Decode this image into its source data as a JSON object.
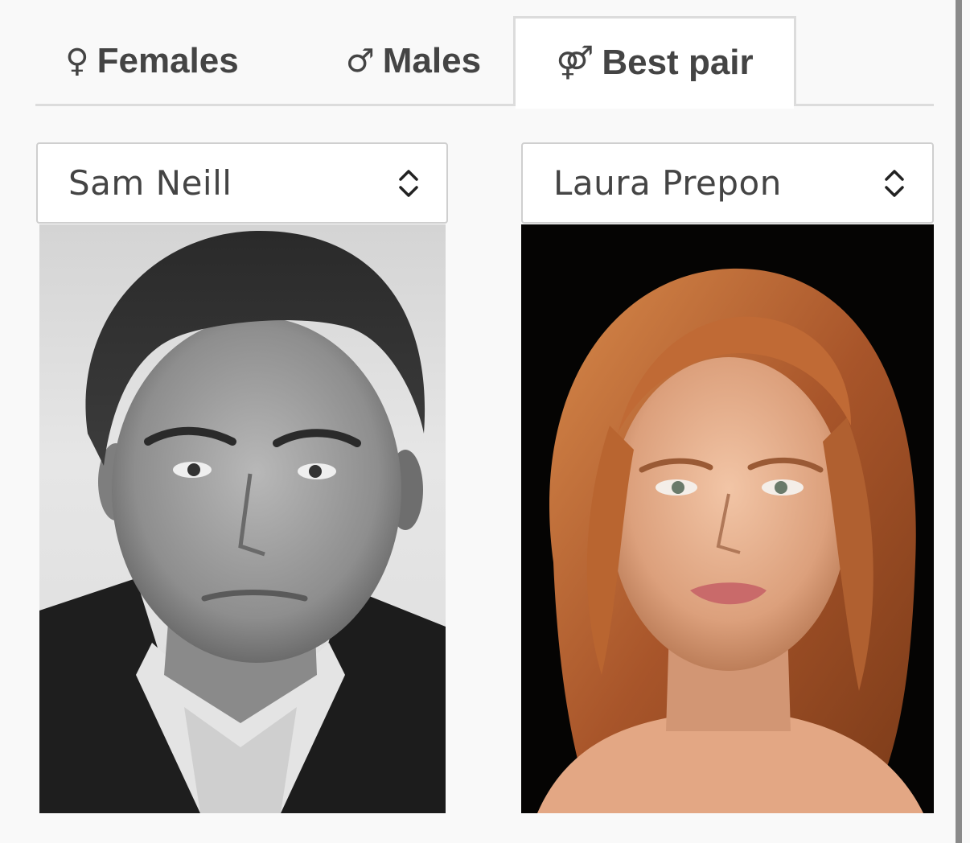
{
  "tabs": [
    {
      "symbol": "♀",
      "label": "Females"
    },
    {
      "symbol": "♂",
      "label": "Males"
    },
    {
      "symbol": "⚤",
      "label": "Best pair"
    }
  ],
  "active_tab": "Best pair",
  "selects": {
    "left": {
      "value": "Sam Neill",
      "icon": "updown-chevron-icon"
    },
    "right": {
      "value": "Laura Prepon",
      "icon": "updown-chevron-icon"
    }
  },
  "photos": {
    "left": {
      "style": "black-and-white portrait"
    },
    "right": {
      "style": "color portrait"
    }
  },
  "colors": {
    "background": "#f9f9f9",
    "tab_text": "#444444",
    "border": "#dcdcdc"
  }
}
